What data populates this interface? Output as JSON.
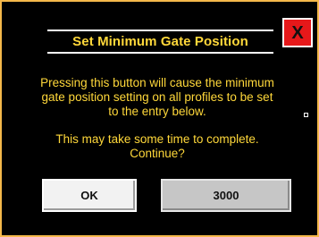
{
  "dialog": {
    "title": "Set Minimum Gate Position",
    "close_label": "X",
    "message_lines_1": "Pressing this button will cause the minimum gate position setting on all profiles to be set to the entry below.",
    "message_lines_2": "This may take some time to complete. Continue?",
    "ok_label": "OK",
    "entry_value": "3000"
  },
  "colors": {
    "background": "#000000",
    "border": "#f4b84a",
    "text": "#ffd83a",
    "close_red": "#e6181a"
  }
}
